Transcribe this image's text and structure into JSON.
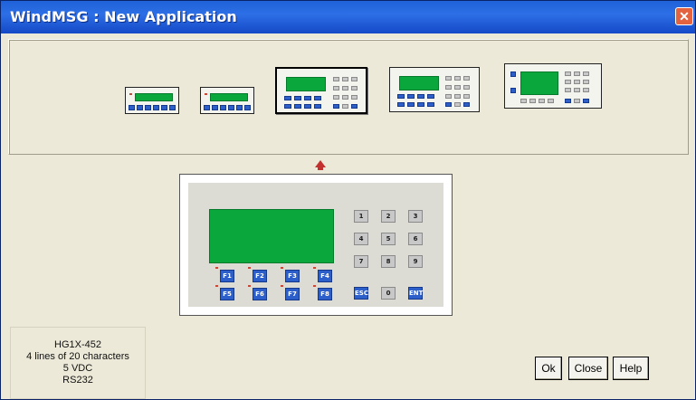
{
  "window": {
    "title": "WindMSG : New Application",
    "close_icon": "close-icon"
  },
  "keypad": {
    "f_keys": [
      "F1",
      "F2",
      "F3",
      "F4",
      "F5",
      "F6",
      "F7",
      "F8"
    ],
    "num_keys": [
      "1",
      "2",
      "3",
      "4",
      "5",
      "6",
      "7",
      "8",
      "9",
      "ESC",
      "0",
      "ENT"
    ]
  },
  "device_info": {
    "model": "HG1X-452",
    "display": "4 lines of 20 characters",
    "power": "5 VDC",
    "comm": "RS232"
  },
  "buttons": {
    "ok": "Ok",
    "close": "Close",
    "help": "Help"
  },
  "colors": {
    "titlebar": "#1f62d8",
    "lcd": "#0aa83c",
    "key_blue": "#2c5fc9",
    "key_gray": "#c8c8c8",
    "panel": "#ece9d8"
  }
}
